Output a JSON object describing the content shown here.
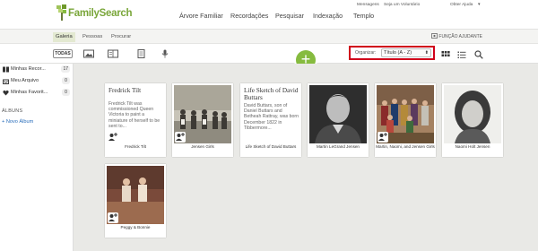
{
  "brand": {
    "name": "FamilySearch"
  },
  "utility_links": [
    "Mensagens",
    "Seja um Voluntário",
    "Obter Ajuda"
  ],
  "utility_dropdown_arrow": "▾",
  "main_nav": [
    "Árvore Familiar",
    "Recordações",
    "Pesquisar",
    "Indexação",
    "Templo"
  ],
  "sub_nav": {
    "tabs": [
      "Galeria",
      "Pessoas",
      "Procurar"
    ],
    "active": "Galeria",
    "helper": "FUNÇÃO AJUDANTE"
  },
  "toolbar": {
    "all_label": "TODAS",
    "filter_icons": [
      "photo-icon",
      "book-icon",
      "document-icon",
      "microphone-icon"
    ],
    "add_symbol": "+",
    "sort_label": "Organizar:",
    "sort_value": "Título (A - Z)",
    "sort_arrow": "⬍",
    "view_icons": [
      "grid-view-icon",
      "list-view-icon",
      "search-icon"
    ]
  },
  "sidebar": {
    "items": [
      {
        "label": "Minhas Recor...",
        "count": "17",
        "icon": "gallery-icon"
      },
      {
        "label": "Meu Arquivo",
        "count": "0",
        "icon": "inbox-icon"
      },
      {
        "label": "Minhas Favorit...",
        "count": "0",
        "icon": "heart-icon"
      }
    ],
    "albums_heading": "ÁLBUNS",
    "new_album": "+ Novo Álbum"
  },
  "cards": [
    {
      "type": "story",
      "title": "Fredrick Tilt",
      "excerpt": "Fredrick Tilt was commissioned Queen Victoria to paint a miniature of herself to be sent to...",
      "caption": "Fredrick Tilt"
    },
    {
      "type": "photo",
      "caption": "Jensen Girls"
    },
    {
      "type": "story",
      "title": "Life Sketch of David Buttars",
      "excerpt": "David Buttars, son of Daniel Buttars and Betheah Rattray, was born December 1822 in Tibbermore...",
      "caption": "Life Sketch of David Buttars"
    },
    {
      "type": "photo",
      "caption": "Martin LeGrand Jensen"
    },
    {
      "type": "photo",
      "caption": "Martin, Naomi, and Jensen Girls"
    },
    {
      "type": "photo",
      "caption": "Naomi Holt Jensen"
    },
    {
      "type": "photo",
      "caption": "Peggy & Bonnie"
    }
  ],
  "colors": {
    "brand_green": "#86bb3f",
    "link_blue": "#2a6ebb",
    "highlight_red": "#d0021b"
  }
}
